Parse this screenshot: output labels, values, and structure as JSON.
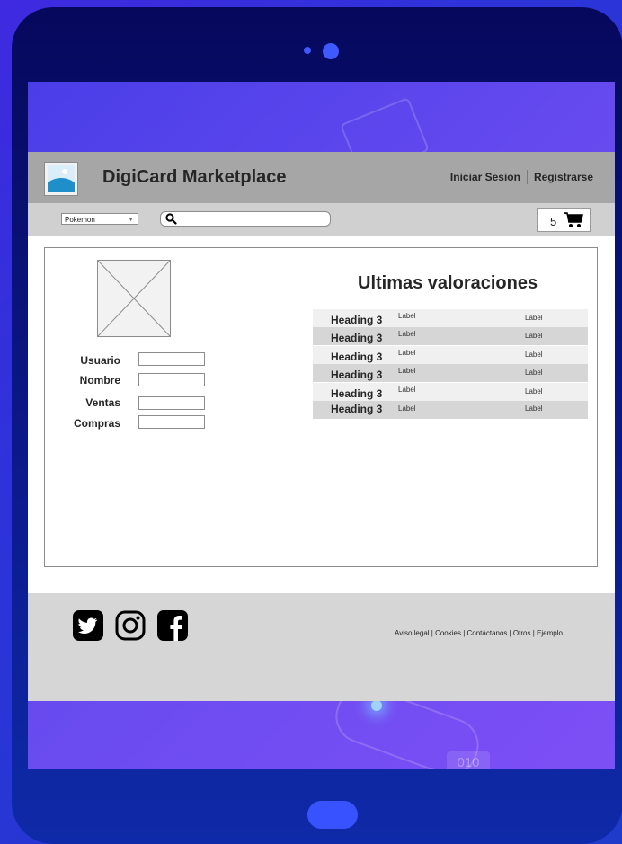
{
  "header": {
    "brand": "DigiCard Marketplace",
    "login_label": "Iniciar Sesion",
    "register_label": "Registrarse"
  },
  "toolbar": {
    "category_value": "Pokemon",
    "search_value": "",
    "cart_count": "5"
  },
  "profile": {
    "fields": [
      {
        "label": "Usuario",
        "value": ""
      },
      {
        "label": "Nombre",
        "value": ""
      },
      {
        "label": "Ventas",
        "value": ""
      },
      {
        "label": "Compras",
        "value": ""
      }
    ]
  },
  "ratings": {
    "title": "Ultimas valoraciones",
    "rows": [
      {
        "heading": "Heading 3",
        "label1": "Label",
        "label2": "Label"
      },
      {
        "heading": "Heading 3",
        "label1": "Label",
        "label2": "Label"
      },
      {
        "heading": "Heading 3",
        "label1": "Label",
        "label2": "Label"
      },
      {
        "heading": "Heading 3",
        "label1": "Label",
        "label2": "Label"
      },
      {
        "heading": "Heading 3",
        "label1": "Label",
        "label2": "Label"
      },
      {
        "heading": "Heading 3",
        "label1": "Label",
        "label2": "Label"
      }
    ]
  },
  "background": {
    "bits_text": "010"
  },
  "footer": {
    "links": "Aviso legal | Cookies | Contáctanos | Otros | Ejemplo"
  },
  "colors": {
    "header_bg": "#a6a6a6",
    "toolbar_bg": "#d0d0d0",
    "footer_bg": "#d6d6d6",
    "row_light": "#f0f0f0",
    "row_dark": "#d6d6d6",
    "device_frame": "#06085c"
  }
}
